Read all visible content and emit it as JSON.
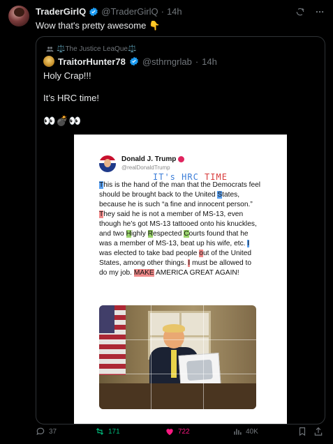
{
  "author": {
    "display_name": "TraderGirlQ",
    "handle": "@TraderGirlQ",
    "time": "14h",
    "verified": true
  },
  "post": {
    "text": "Wow that's pretty awesome",
    "emoji": "👇"
  },
  "quoted": {
    "community": "⚖️The Justice LeaQue⚖️",
    "display_name": "TraitorHunter78",
    "handle": "@sthrngrlab",
    "time": "14h",
    "verified": true,
    "line1": "Holy Crap!!!",
    "line2": "It’s HRC time!",
    "emojis": "👀💣👀",
    "embed": {
      "name": "Donald J. Trump",
      "handle": "@realDonaldTrump",
      "scrawl_blue": "IT's HRC",
      "scrawl_red": "TIME",
      "body_parts": {
        "p1": "T",
        "p2": "his is the hand of the man that the Democrats feel should be brought back to the United ",
        "p3": "S",
        "p4": "tates, because he is such “a fine and innocent person.” ",
        "p5": "T",
        "p6": "hey said he is not a member of MS-13, even though he’s got MS-13 tattooed onto his knuckles, and two ",
        "p7": "H",
        "p8": "ighly ",
        "p9": "R",
        "p10": "espected ",
        "p11": "C",
        "p12": "ourts found that he was a member of MS-13, beat up his wife, etc. ",
        "p13": "I",
        "p14": " was elected to take bad people ",
        "p15": "o",
        "p16": "ut of the United States, among other things. ",
        "p17": "I",
        "p18": " must be allowed to do my job. ",
        "p19": "MAKE",
        "p20": " AMERICA GREAT AGAIN!"
      }
    }
  },
  "actions": {
    "replies": "37",
    "reposts": "171",
    "likes": "722",
    "views": "40K"
  },
  "colors": {
    "background": "#000000",
    "text": "#e7e9ea",
    "muted": "#71767b",
    "verified": "#1d9bf0",
    "repost": "#00ba7c",
    "like": "#f91880"
  }
}
